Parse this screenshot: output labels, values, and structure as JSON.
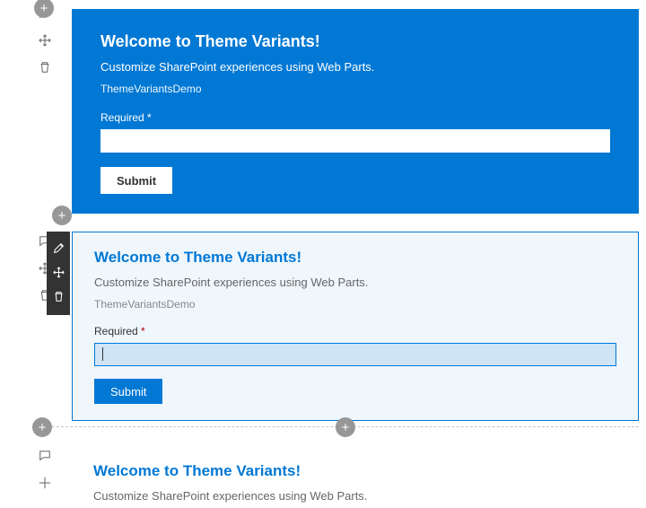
{
  "webpart": {
    "title": "Welcome to Theme Variants!",
    "subtitle": "Customize SharePoint experiences using Web Parts.",
    "demoName": "ThemeVariantsDemo",
    "fieldLabel": "Required",
    "asterisk": "*",
    "submitLabel": "Submit"
  },
  "sections": [
    {
      "variant": "strong",
      "bg": "#0078d4"
    },
    {
      "variant": "soft",
      "bg": "#eff6fc",
      "selected": true
    },
    {
      "variant": "none",
      "bg": "#ffffff"
    }
  ],
  "tools": {
    "comment": "comment-icon",
    "move": "move-icon",
    "delete": "trash-icon",
    "edit": "pencil-icon"
  }
}
